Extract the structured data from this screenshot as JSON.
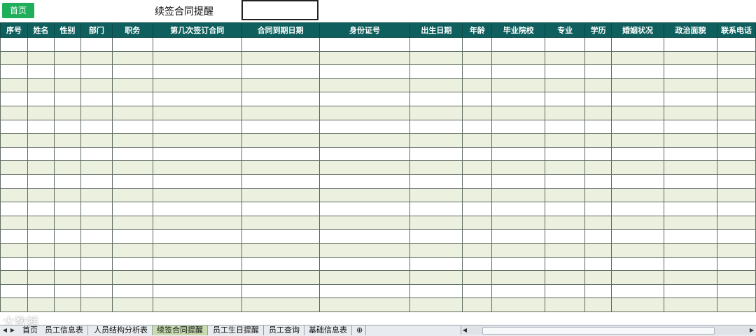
{
  "header": {
    "home_button": "首页",
    "title": "续签合同提醒",
    "date_box_value": ""
  },
  "table": {
    "columns": [
      "序号",
      "姓名",
      "性别",
      "部门",
      "职务",
      "第几次签订合同",
      "合同到期日期",
      "身份证号",
      "出生日期",
      "年龄",
      "毕业院校",
      "专业",
      "学历",
      "婚姻状况",
      "政治面貌",
      "联系电话"
    ],
    "row_count": 20
  },
  "watermark": "大数据",
  "sheet_tabs": [
    "首页",
    "员工信息表",
    "人员结构分析表",
    "续签合同提醒",
    "员工生日提醒",
    "员工查询",
    "基础信息表"
  ],
  "active_tab": "续签合同提醒",
  "colors": {
    "header_bg": "#0e5f5d",
    "band_even": "#ecf0de",
    "home_button_bg": "#1fae5a"
  }
}
